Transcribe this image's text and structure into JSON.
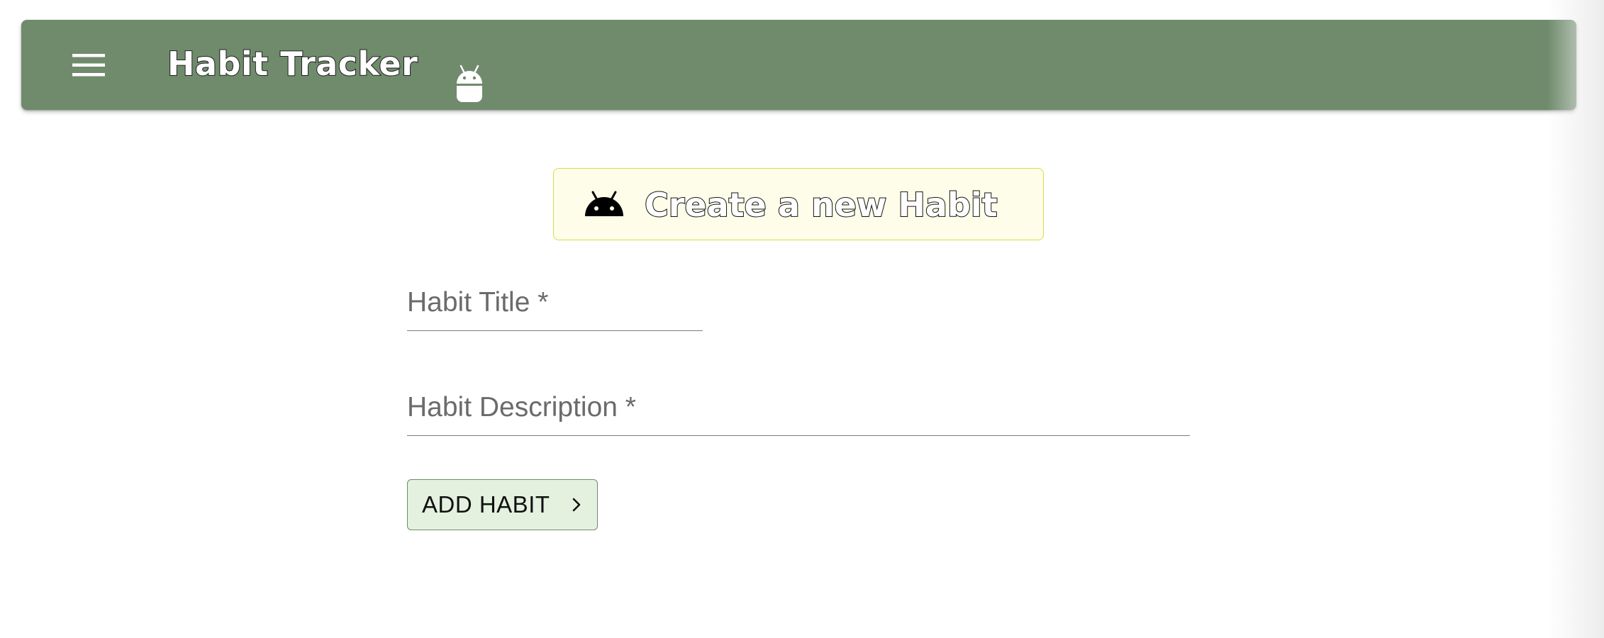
{
  "appbar": {
    "title": "Habit Tracker",
    "background": "#6f8b6c",
    "menu_icon": "hamburger-menu-icon",
    "title_icon": "android-icon"
  },
  "header_card": {
    "icon": "android-head-icon",
    "title": "Create a new Habit",
    "background": "#fefde9",
    "border": "#d8dc4a"
  },
  "form": {
    "title_field": {
      "label": "Habit Title *",
      "value": ""
    },
    "description_field": {
      "label": "Habit Description *",
      "value": ""
    },
    "submit_button": {
      "label": "ADD HABIT",
      "icon": "chevron-right-icon",
      "background": "#e5f1df"
    }
  }
}
